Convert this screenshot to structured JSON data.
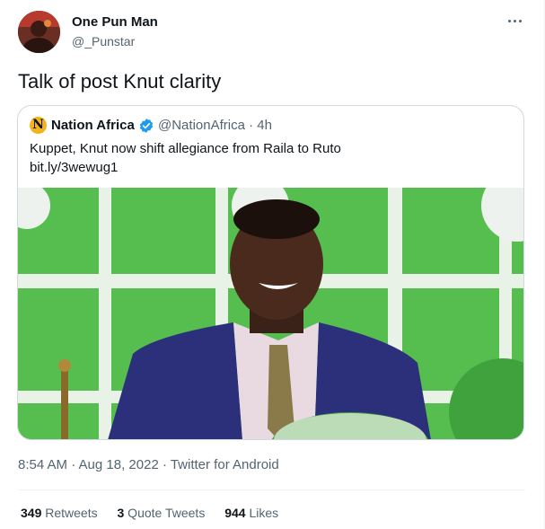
{
  "tweet": {
    "author_name": "One Pun Man",
    "author_handle": "@_Punstar",
    "text": "Talk of post Knut clarity",
    "avatar_icon": "user-avatar",
    "more_icon": "more-horizontal-icon"
  },
  "quote": {
    "avatar_letter": "N",
    "author_name": "Nation Africa",
    "handle_time": "@NationAfrica · 4h",
    "verified_icon": "verified-badge-icon",
    "text": "Kuppet, Knut now shift allegiance from Raila to Ruto",
    "link": "bit.ly/3wewug1"
  },
  "meta": {
    "timestamp": "8:54 AM · Aug 18, 2022 · Twitter for Android"
  },
  "stats": {
    "retweets_count": "349",
    "retweets_label": " Retweets",
    "quotes_count": "3",
    "quotes_label": " Quote Tweets",
    "likes_count": "944",
    "likes_label": " Likes"
  },
  "colors": {
    "text": "#0f1419",
    "secondary": "#536471",
    "verified": "#1d9bf0",
    "image_green": "#4fb84a"
  }
}
